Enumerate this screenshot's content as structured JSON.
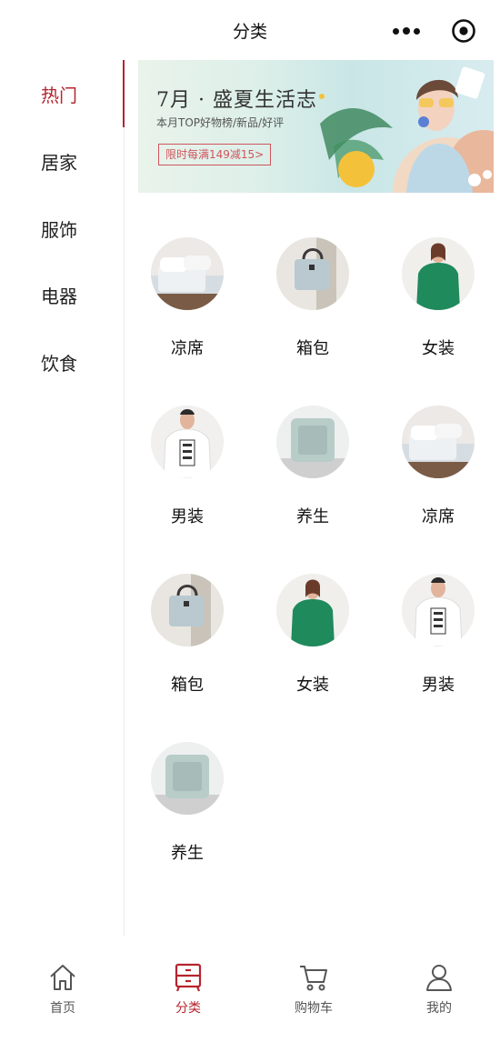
{
  "header": {
    "title": "分类"
  },
  "sidebar": {
    "items": [
      {
        "label": "热门",
        "active": true
      },
      {
        "label": "居家",
        "active": false
      },
      {
        "label": "服饰",
        "active": false
      },
      {
        "label": "电器",
        "active": false
      },
      {
        "label": "饮食",
        "active": false
      }
    ]
  },
  "banner": {
    "title": "7月 · 盛夏生活志",
    "subtitle": "本月TOP好物榜/新品/好评",
    "tag": "限时每满149减15>"
  },
  "categories": [
    {
      "label": "凉席",
      "image": "bedding"
    },
    {
      "label": "箱包",
      "image": "handbag"
    },
    {
      "label": "女装",
      "image": "women-green-polo"
    },
    {
      "label": "男装",
      "image": "men-white-tee"
    },
    {
      "label": "养生",
      "image": "cushion"
    },
    {
      "label": "凉席",
      "image": "bedding"
    },
    {
      "label": "箱包",
      "image": "handbag"
    },
    {
      "label": "女装",
      "image": "women-green-polo"
    },
    {
      "label": "男装",
      "image": "men-white-tee"
    },
    {
      "label": "养生",
      "image": "cushion"
    }
  ],
  "tabbar": {
    "items": [
      {
        "label": "首页",
        "icon": "home-icon",
        "active": false
      },
      {
        "label": "分类",
        "icon": "category-icon",
        "active": true
      },
      {
        "label": "购物车",
        "icon": "cart-icon",
        "active": false
      },
      {
        "label": "我的",
        "icon": "user-icon",
        "active": false
      }
    ]
  },
  "colors": {
    "accent": "#b5242f",
    "text": "#222222",
    "muted": "#555555",
    "divider": "#ececec"
  }
}
